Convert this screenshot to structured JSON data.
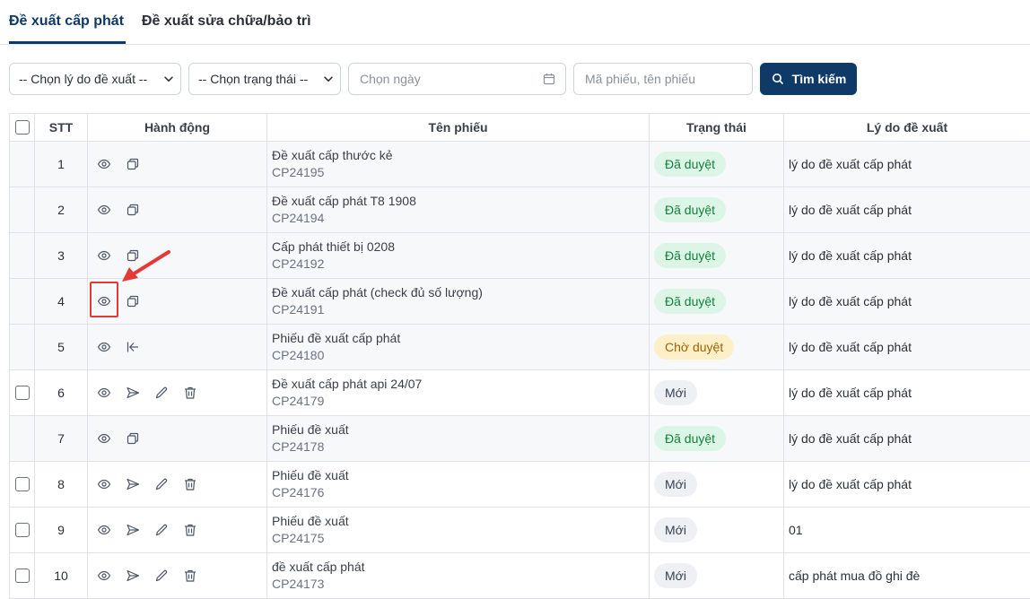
{
  "tabs": [
    {
      "label": "Đề xuất cấp phát",
      "active": true
    },
    {
      "label": "Đề xuất sửa chữa/bảo trì",
      "active": false
    }
  ],
  "filters": {
    "reason_select": "-- Chọn lý do đề xuất --",
    "status_select": "-- Chọn trạng thái --",
    "date_placeholder": "Chọn ngày",
    "search_placeholder": "Mã phiếu, tên phiếu",
    "search_button": "Tìm kiếm"
  },
  "table": {
    "headers": {
      "stt": "STT",
      "actions": "Hành động",
      "name": "Tên phiếu",
      "status": "Trạng thái",
      "reason": "Lý do đề xuất"
    },
    "rows": [
      {
        "stt": "1",
        "title": "Đề xuất cấp thước kẻ",
        "code": "CP24195",
        "status": "Đã duyệt",
        "status_type": "approved",
        "reason": "lý do đề xuất cấp phát",
        "checkbox": false,
        "actions": [
          "view",
          "copy"
        ]
      },
      {
        "stt": "2",
        "title": "Đề xuất cấp phát T8 1908",
        "code": "CP24194",
        "status": "Đã duyệt",
        "status_type": "approved",
        "reason": "lý do đề xuất cấp phát",
        "checkbox": false,
        "actions": [
          "view",
          "copy"
        ]
      },
      {
        "stt": "3",
        "title": "Cấp phát thiết bị 0208",
        "code": "CP24192",
        "status": "Đã duyệt",
        "status_type": "approved",
        "reason": "lý do đề xuất cấp phát",
        "checkbox": false,
        "actions": [
          "view",
          "copy"
        ]
      },
      {
        "stt": "4",
        "title": "Đề xuất cấp phát (check đủ số lượng)",
        "code": "CP24191",
        "status": "Đã duyệt",
        "status_type": "approved",
        "reason": "lý do đề xuất cấp phát",
        "checkbox": false,
        "actions": [
          "view",
          "copy"
        ]
      },
      {
        "stt": "5",
        "title": "Phiếu đề xuất cấp phát",
        "code": "CP24180",
        "status": "Chờ duyệt",
        "status_type": "pending",
        "reason": "lý do đề xuất cấp phát",
        "checkbox": false,
        "actions": [
          "view",
          "revoke"
        ]
      },
      {
        "stt": "6",
        "title": "Đề xuất cấp phát api 24/07",
        "code": "CP24179",
        "status": "Mới",
        "status_type": "new",
        "reason": "lý do đề xuất cấp phát",
        "checkbox": true,
        "actions": [
          "view",
          "send",
          "edit",
          "delete"
        ]
      },
      {
        "stt": "7",
        "title": "Phiếu đề xuất",
        "code": "CP24178",
        "status": "Đã duyệt",
        "status_type": "approved",
        "reason": "lý do đề xuất cấp phát",
        "checkbox": false,
        "actions": [
          "view",
          "copy"
        ]
      },
      {
        "stt": "8",
        "title": "Phiếu đề xuất",
        "code": "CP24176",
        "status": "Mới",
        "status_type": "new",
        "reason": "lý do đề xuất cấp phát",
        "checkbox": true,
        "actions": [
          "view",
          "send",
          "edit",
          "delete"
        ]
      },
      {
        "stt": "9",
        "title": "Phiếu đề xuất",
        "code": "CP24175",
        "status": "Mới",
        "status_type": "new",
        "reason": "01",
        "checkbox": true,
        "actions": [
          "view",
          "send",
          "edit",
          "delete"
        ]
      },
      {
        "stt": "10",
        "title": "đề xuất cấp phát",
        "code": "CP24173",
        "status": "Mới",
        "status_type": "new",
        "reason": "cấp phát mua đồ ghi đè",
        "checkbox": true,
        "actions": [
          "view",
          "send",
          "edit",
          "delete"
        ]
      }
    ]
  },
  "icons": {
    "view": "eye-icon",
    "copy": "copy-icon",
    "revoke": "revoke-icon",
    "send": "send-icon",
    "edit": "pencil-icon",
    "delete": "trash-icon",
    "calendar": "calendar-icon",
    "search": "search-icon",
    "chevron": "chevron-down-icon"
  },
  "colors": {
    "primary": "#0f3a67",
    "approved_bg": "#dcf5e6",
    "approved_text": "#15803d",
    "pending_bg": "#fdf0c8",
    "pending_text": "#a16207",
    "new_bg": "#eef0f3",
    "annotation": "#e53935"
  }
}
